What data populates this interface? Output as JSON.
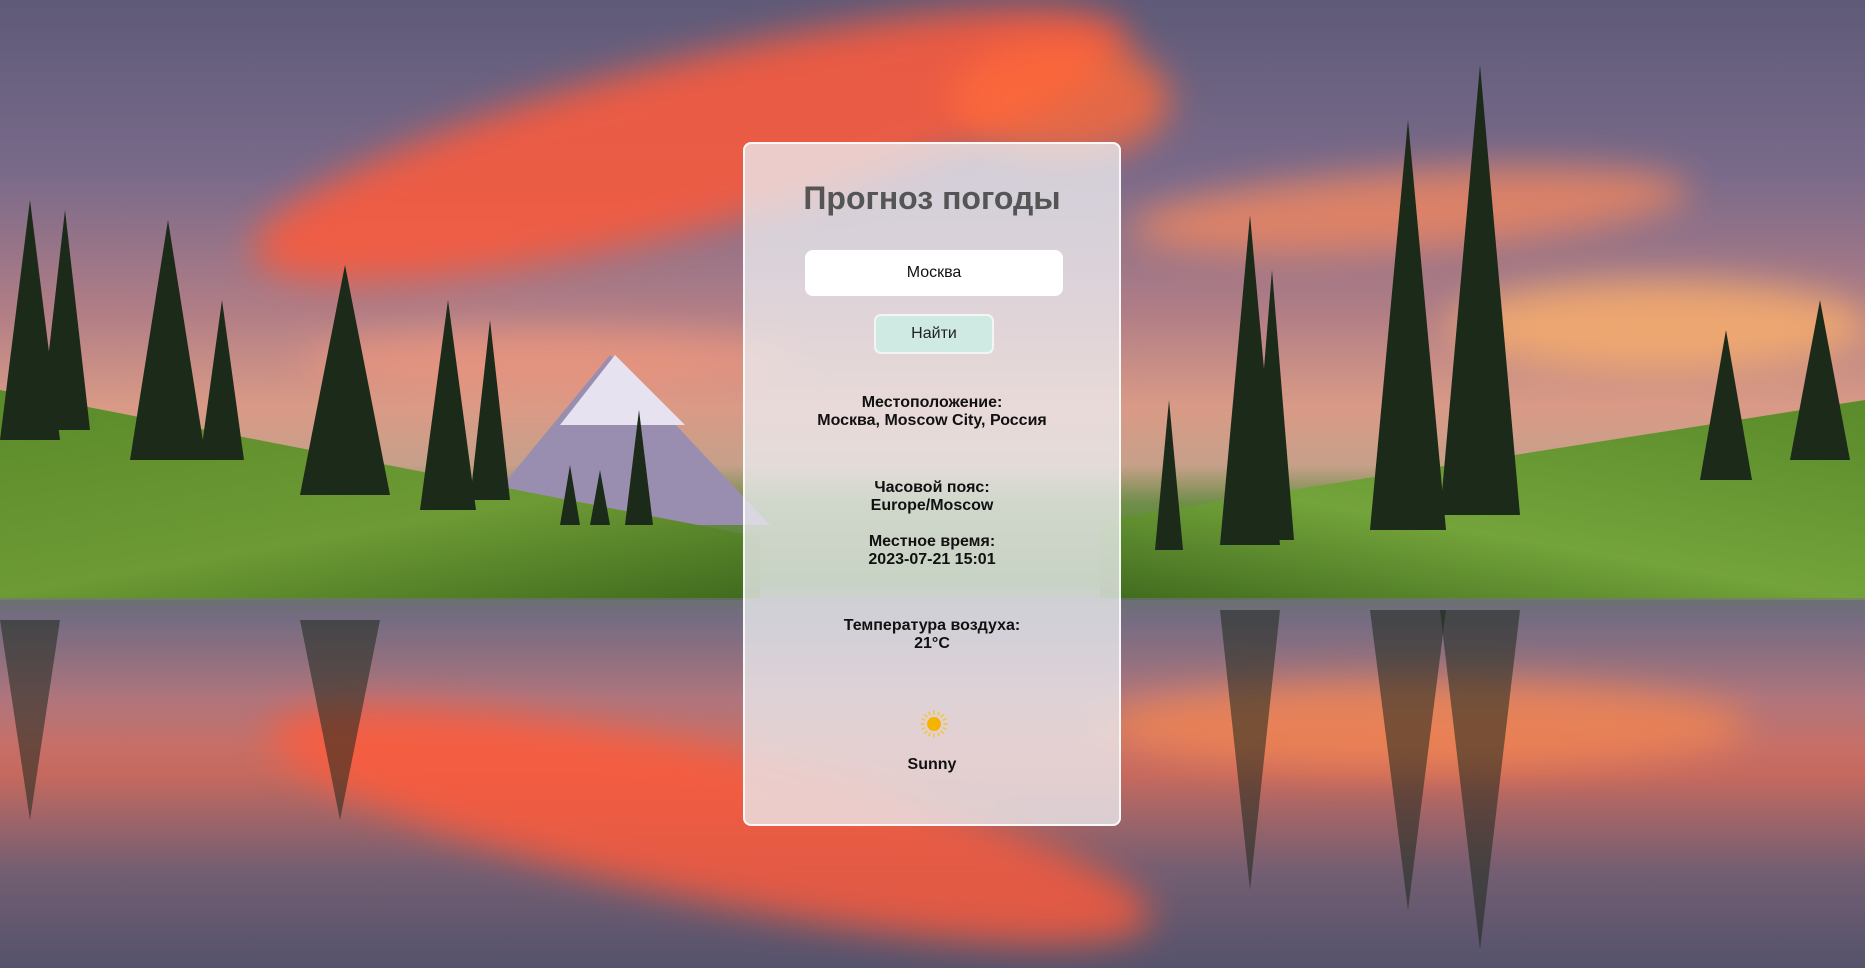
{
  "app": {
    "title": "Прогноз погоды"
  },
  "search": {
    "value": "Москва",
    "button_label": "Найти"
  },
  "weather": {
    "location_label": "Местоположение:",
    "location_value": "Москва, Moscow City, Россия",
    "timezone_label": "Часовой пояс:",
    "timezone_value": "Europe/Moscow",
    "localtime_label": "Местное время:",
    "localtime_value": "2023-07-21 15:01",
    "temperature_label": "Температура воздуха:",
    "temperature_value": "21°C",
    "condition_icon": "sun-icon",
    "condition_text": "Sunny"
  },
  "colors": {
    "card_background": "#ececf0",
    "button_background": "#cfe9e3",
    "title_color": "#555555",
    "sun_color": "#f4b400"
  }
}
